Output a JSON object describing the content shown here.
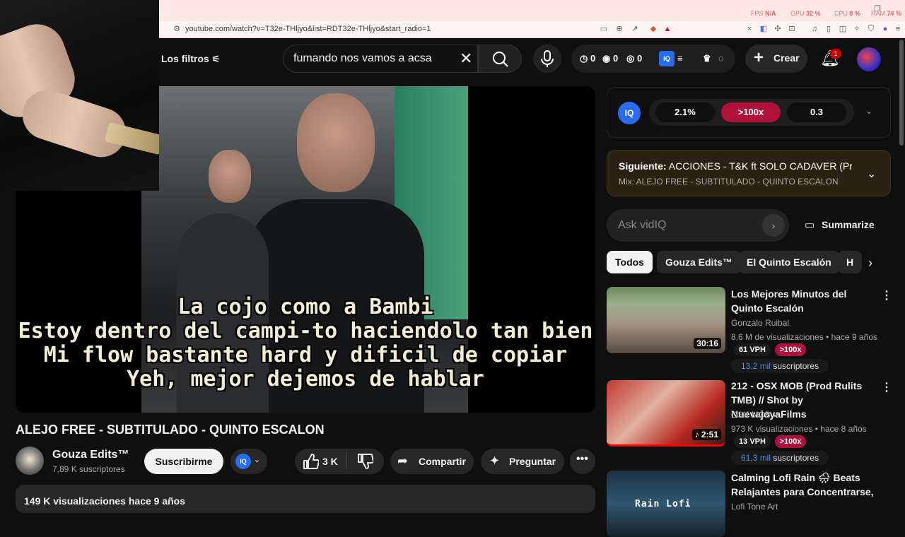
{
  "browser": {
    "url": "youtube.com/watch?v=T32e-THljyo&list=RDT32e-THljyo&start_radio=1",
    "perf": [
      {
        "label": "FPS",
        "value": "N/A"
      },
      {
        "label": "GPU",
        "value": "32 %"
      },
      {
        "label": "CPU",
        "value": "8 %"
      },
      {
        "label": "RAM",
        "value": "74 %"
      }
    ]
  },
  "header": {
    "filters_label": "Los filtros",
    "search_query": "fumando nos vamos a acsa",
    "stats": [
      "0",
      "0",
      "0"
    ],
    "create_label": "Crear",
    "notification_count": "1"
  },
  "video": {
    "subtitles": [
      "La cojo como a Bambi",
      "Estoy dentro del campi-to haciendolo tan bien",
      "Mi flow bastante hard y dificil de copiar",
      "Yeh, mejor dejemos de hablar"
    ],
    "title": "ALEJO FREE - SUBTITULADO - QUINTO ESCALON",
    "channel": "Gouza Edits™",
    "channel_subs": "7,89 K suscriptores",
    "subscribe_label": "Suscribirme",
    "likes": "3 K",
    "share_label": "Compartir",
    "ask_label": "Preguntar",
    "description_line": "149 K visualizaciones  hace 9 años"
  },
  "vidiq": {
    "logo": "IQ",
    "metrics": [
      "2.1%",
      ">100x",
      "0.3"
    ],
    "metric_colors": [
      "#0f0f0f",
      "#b0103a",
      "#0f0f0f"
    ]
  },
  "next": {
    "prefix": "Siguiente:",
    "title": "ACCIONES - T&K ft SOLO CADAVER (Pro...",
    "mix": "Mix: ALEJO FREE - SUBTITULADO - QUINTO ESCALON"
  },
  "ask": {
    "placeholder": "Ask vidIQ",
    "summarize_label": "Summarize"
  },
  "chips": [
    "Todos",
    "Gouza Edits™",
    "El Quinto Escalón",
    "H"
  ],
  "recommendations": [
    {
      "title": "Los Mejores Minutos del Quinto Escalón",
      "channel": "Gonzalo Ruibal",
      "verified": false,
      "views": "8,6 M de visualizaciones",
      "age": "hace 9 años",
      "duration": "30:16",
      "vph": "61 VPH",
      "ratio": ">100x",
      "subs_value": "13,2 mil",
      "subs_label": "suscriptores"
    },
    {
      "title": "212 - OSX MOB (Prod Rulits TMB) // Shot by NuevajoyaFilms",
      "channel": "OSX MOB",
      "verified": true,
      "views": "973 K visualizaciones",
      "age": "hace 8 años",
      "duration": "2:51",
      "vph": "13 VPH",
      "ratio": ">100x",
      "subs_value": "61,3 mil",
      "subs_label": "suscriptores"
    },
    {
      "title": "Calming Lofi Rain 🌧 Beats Relajantes para Concentrarse, ...",
      "channel": "Lofi Tone Art",
      "verified": false,
      "thumb_text": "Rain Lofi"
    }
  ]
}
